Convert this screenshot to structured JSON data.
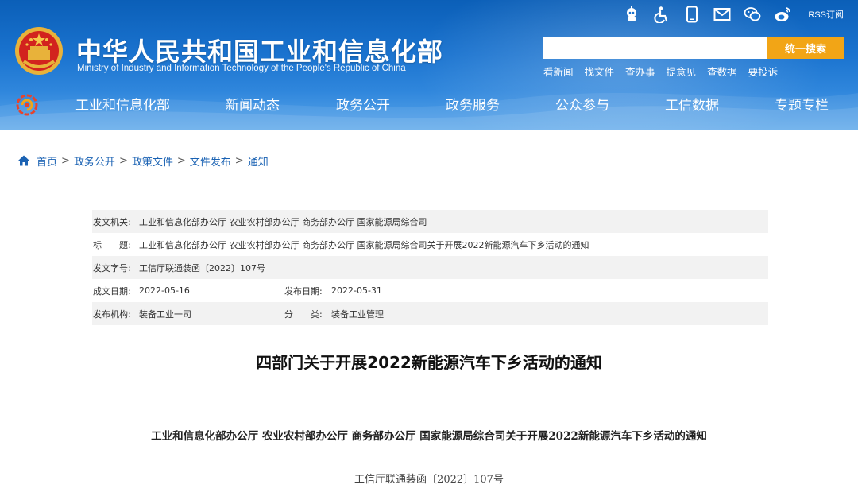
{
  "header": {
    "title": "中华人民共和国工业和信息化部",
    "subtitle": "Ministry of Industry and Information Technology of the People's Republic of China",
    "top_icons": [
      "robot-icon",
      "accessibility-icon",
      "mobile-icon",
      "mail-icon",
      "wechat-icon",
      "weibo-icon",
      "rss-icon"
    ],
    "rss_label": "RSS订阅",
    "search": {
      "placeholder": "",
      "value": "",
      "button_label": "统一搜索"
    },
    "quick_links": [
      "看新闻",
      "找文件",
      "查办事",
      "提意见",
      "查数据",
      "要投诉"
    ],
    "nav": [
      "工业和信息化部",
      "新闻动态",
      "政务公开",
      "政务服务",
      "公众参与",
      "工信数据",
      "专题专栏"
    ]
  },
  "breadcrumb": [
    "首页",
    "政务公开",
    "政策文件",
    "文件发布",
    "通知"
  ],
  "info": {
    "issuer_label": "发文机关:",
    "issuer": "工业和信息化部办公厅 农业农村部办公厅 商务部办公厅 国家能源局综合司",
    "title_label": "标　　题:",
    "title": "工业和信息化部办公厅 农业农村部办公厅 商务部办公厅 国家能源局综合司关于开展2022新能源汽车下乡活动的通知",
    "docno_label": "发文字号:",
    "docno": "工信厅联通装函〔2022〕107号",
    "created_label": "成文日期:",
    "created": "2022-05-16",
    "published_label": "发布日期:",
    "published": "2022-05-31",
    "org_label": "发布机构:",
    "org": "装备工业一司",
    "category_label": "分　　类:",
    "category": "装备工业管理"
  },
  "article": {
    "title": "四部门关于开展2022新能源汽车下乡活动的通知",
    "lead": "工业和信息化部办公厅 农业农村部办公厅 商务部办公厅 国家能源局综合司关于开展2022新能源汽车下乡活动的通知",
    "doc_no": "工信厅联通装函〔2022〕107号"
  },
  "colors": {
    "header_blue": "#1a73cf",
    "search_button": "#f2a516",
    "link_blue": "#1a62b3",
    "row_shade": "#f2f2f2"
  }
}
